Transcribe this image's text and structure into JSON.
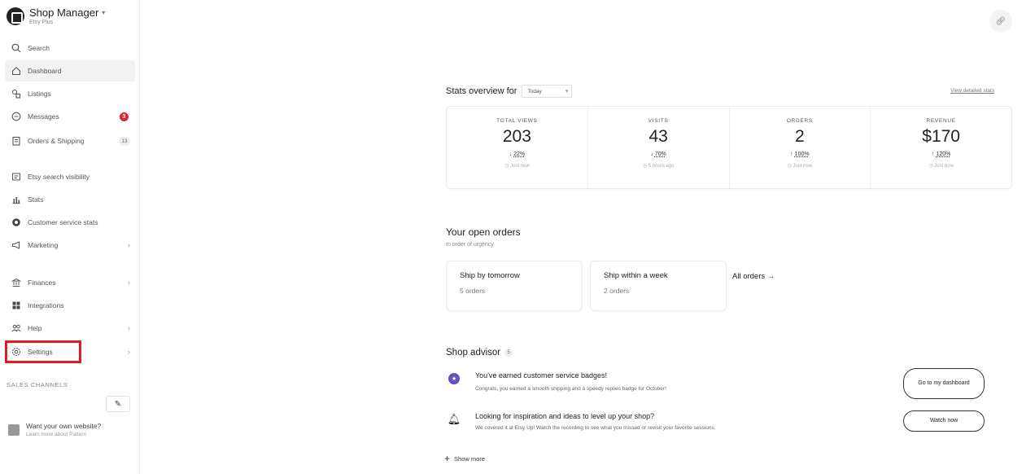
{
  "sidebar": {
    "brand_name": "Shop Manager",
    "brand_plan": "Etsy Plus",
    "items": [
      {
        "label": "Search"
      },
      {
        "label": "Dashboard"
      },
      {
        "label": "Listings"
      },
      {
        "label": "Messages",
        "badge": "3"
      },
      {
        "label": "Orders & Shipping",
        "badge": "13"
      },
      {
        "label": "Etsy search visibility"
      },
      {
        "label": "Stats"
      },
      {
        "label": "Customer service stats"
      },
      {
        "label": "Marketing"
      },
      {
        "label": "Finances"
      },
      {
        "label": "Integrations"
      },
      {
        "label": "Help"
      },
      {
        "label": "Settings"
      }
    ],
    "sales_channels_label": "SALES CHANNELS",
    "pattern_title": "Want your own website?",
    "pattern_sub": "Learn more about Pattern"
  },
  "stats": {
    "title_prefix": "Stats overview for",
    "period": "Today",
    "view_link": "View detailed stats",
    "cards": [
      {
        "label": "TOTAL VIEWS",
        "value": "203",
        "arrow": "↓",
        "change": "22%",
        "updated": "Just now"
      },
      {
        "label": "VISITS",
        "value": "43",
        "arrow": "↓",
        "change": "70%",
        "updated": "5 hours ago"
      },
      {
        "label": "ORDERS",
        "value": "2",
        "arrow": "↑",
        "change": "100%",
        "updated": "Just now"
      },
      {
        "label": "REVENUE",
        "value": "$170",
        "arrow": "↑",
        "change": "120%",
        "updated": "Just now"
      }
    ]
  },
  "open_orders": {
    "title": "Your open orders",
    "subtitle": "In order of urgency",
    "cards": [
      {
        "title": "Ship by tomorrow",
        "count": "5 orders"
      },
      {
        "title": "Ship within a week",
        "count": "2 orders"
      }
    ],
    "all_orders": "All orders →"
  },
  "advisor": {
    "title": "Shop advisor",
    "count": "5",
    "items": [
      {
        "title": "You've earned customer service badges!",
        "subtitle": "Congrats, you earned a smooth shipping and a speedy replies badge for October!",
        "button": "Go to my dashboard"
      },
      {
        "title": "Looking for inspiration and ideas to level up your shop?",
        "subtitle": "We covered it at Etsy Up! Watch the recording to see what you missed or revisit your favorite sessions.",
        "button": "Watch now"
      }
    ],
    "show_more": "Show more"
  },
  "colors": {
    "accent_red": "#e01b24",
    "badge_red": "#d7263d",
    "badge_purple": "#6b4fbb"
  }
}
